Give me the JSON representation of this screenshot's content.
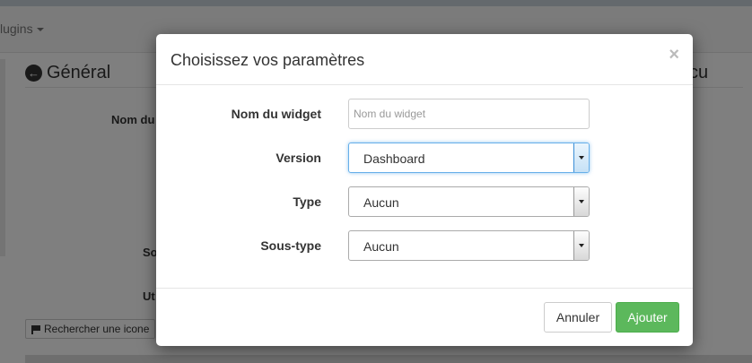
{
  "background": {
    "nav_plugins": "lugins",
    "general_title": "Général",
    "label_nom": "Nom du",
    "label_so": "So",
    "label_ut": "Ut",
    "right_title": "cu",
    "search_icon_button": "Rechercher une icone"
  },
  "modal": {
    "title": "Choisissez vos paramètres",
    "close": "×",
    "fields": {
      "nom": {
        "label": "Nom du widget",
        "placeholder": "Nom du widget",
        "value": ""
      },
      "version": {
        "label": "Version",
        "value": "Dashboard"
      },
      "type": {
        "label": "Type",
        "value": "Aucun"
      },
      "soustype": {
        "label": "Sous-type",
        "value": "Aucun"
      }
    },
    "buttons": {
      "cancel": "Annuler",
      "add": "Ajouter"
    }
  },
  "colors": {
    "primary_success": "#5cb85c",
    "focus": "#66afe9"
  }
}
